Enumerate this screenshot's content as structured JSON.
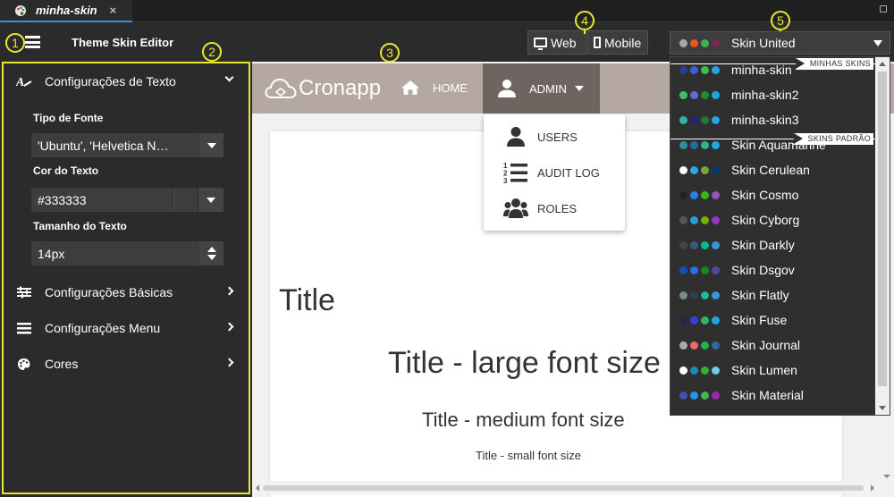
{
  "tab": {
    "label": "minha-skin",
    "close": "×"
  },
  "header": {
    "title": "Theme Skin Editor",
    "web_label": "Web",
    "mobile_label": "Mobile",
    "selected_skin": "Skin United",
    "selected_skin_colors": [
      "#a8a8a8",
      "#e95420",
      "#38b44a",
      "#772953"
    ]
  },
  "markers": [
    "1",
    "2",
    "3",
    "4",
    "5"
  ],
  "left_panel": {
    "text_section": "Configurações de Texto",
    "font_type_label": "Tipo de Fonte",
    "font_type_value": "'Ubuntu', 'Helvetica N…",
    "text_color_label": "Cor do Texto",
    "text_color_value": "#333333",
    "text_size_label": "Tamanho do Texto",
    "text_size_value": "14px",
    "basic_section": "Configurações Básicas",
    "menu_section": "Configurações Menu",
    "colors_section": "Cores"
  },
  "preview": {
    "brand": "Cronapp",
    "nav_home": "HOME",
    "nav_admin": "ADMIN",
    "admin_menu": [
      "USERS",
      "AUDIT LOG",
      "ROLES"
    ],
    "title": "Title",
    "title_large": "Title - large font size",
    "title_medium": "Title - medium font size",
    "title_small": "Title - small font size",
    "navbar_color": "#b5a8a1",
    "admin_active_color": "#6f6560"
  },
  "skin_list": {
    "my_skins_label": "MINHAS SKINS",
    "default_skins_label": "SKINS PADRÃO",
    "items": [
      {
        "name": "minha-skin",
        "colors": [
          "#2f3e8f",
          "#3a5fd6",
          "#3cbf4e",
          "#1ea7e0"
        ]
      },
      {
        "name": "minha-skin2",
        "colors": [
          "#3cbf6e",
          "#5b6ed6",
          "#1f8a3a",
          "#1ea7e0"
        ]
      },
      {
        "name": "minha-skin3",
        "colors": [
          "#2bb5a8",
          "#2a1f7a",
          "#1f7a3a",
          "#1ea7e0"
        ]
      },
      {
        "name": "Skin Aquamarine",
        "colors": [
          "#2a8f9f",
          "#1f6fa0",
          "#2bb58f",
          "#1ea7e0"
        ]
      },
      {
        "name": "Skin Cerulean",
        "colors": [
          "#ffffff",
          "#2fa4e7",
          "#73a839",
          "#033c73"
        ]
      },
      {
        "name": "Skin Cosmo",
        "colors": [
          "#222222",
          "#2780e3",
          "#3fb618",
          "#9954bb"
        ]
      },
      {
        "name": "Skin Cyborg",
        "colors": [
          "#555555",
          "#2a9fd6",
          "#77b300",
          "#9933cc"
        ]
      },
      {
        "name": "Skin Darkly",
        "colors": [
          "#444444",
          "#375a7f",
          "#00bc8c",
          "#3498db"
        ]
      },
      {
        "name": "Skin Dsgov",
        "colors": [
          "#1351b4",
          "#2670e8",
          "#168821",
          "#4a4a9f"
        ]
      },
      {
        "name": "Skin Flatly",
        "colors": [
          "#7b8a8b",
          "#2c3e50",
          "#18bc9c",
          "#3498db"
        ]
      },
      {
        "name": "Skin Fuse",
        "colors": [
          "#1e2a44",
          "#3c3fd6",
          "#2bb56f",
          "#1ea7e0"
        ]
      },
      {
        "name": "Skin Journal",
        "colors": [
          "#aaaaaa",
          "#eb6864",
          "#22b24c",
          "#336699"
        ]
      },
      {
        "name": "Skin Lumen",
        "colors": [
          "#ffffff",
          "#158cba",
          "#28b62c",
          "#75caeb"
        ]
      },
      {
        "name": "Skin Material",
        "colors": [
          "#3f51b5",
          "#2196f3",
          "#4caf50",
          "#9c27b0"
        ]
      }
    ]
  }
}
